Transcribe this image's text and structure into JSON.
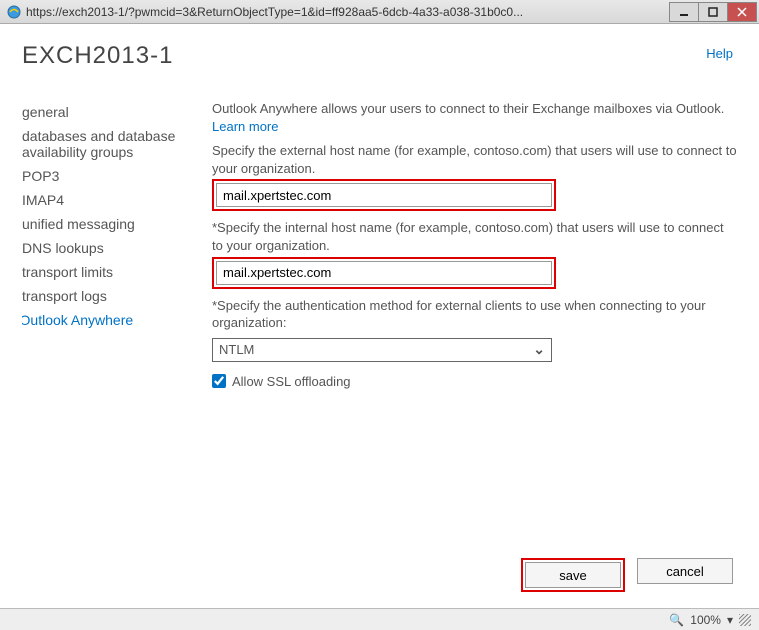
{
  "titlebar": {
    "url": "https://exch2013-1/?pwmcid=3&ReturnObjectType=1&id=ff928aa5-6dcb-4a33-a038-31b0c0..."
  },
  "help_label": "Help",
  "page_title": "EXCH2013-1",
  "sidebar": {
    "items": [
      {
        "label": "general"
      },
      {
        "label": "databases and database availability groups"
      },
      {
        "label": "POP3"
      },
      {
        "label": "IMAP4"
      },
      {
        "label": "unified messaging"
      },
      {
        "label": "DNS lookups"
      },
      {
        "label": "transport limits"
      },
      {
        "label": "transport logs"
      },
      {
        "label": "Outlook Anywhere"
      }
    ],
    "active_index": 8
  },
  "form": {
    "intro_text": "Outlook Anywhere allows your users to connect to their Exchange mailboxes via Outlook. ",
    "learn_more": "Learn more",
    "external_host_label": "Specify the external host name (for example, contoso.com) that users will use to connect to your organization.",
    "external_host_value": "mail.xpertstec.com",
    "internal_host_label": "*Specify the internal host name (for example, contoso.com) that users will use to connect to your organization.",
    "internal_host_value": "mail.xpertstec.com",
    "auth_label": "*Specify the authentication method for external clients to use when connecting to your organization:",
    "auth_value": "NTLM",
    "ssl_offloading_label": "Allow SSL offloading",
    "ssl_offloading_checked": true
  },
  "buttons": {
    "save": "save",
    "cancel": "cancel"
  },
  "statusbar": {
    "zoom": "100%"
  }
}
